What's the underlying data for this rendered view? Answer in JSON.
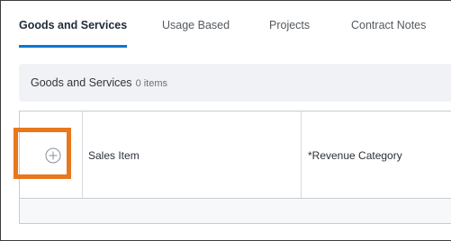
{
  "tabs": [
    {
      "label": "Goods and Services",
      "active": true
    },
    {
      "label": "Usage Based",
      "active": false
    },
    {
      "label": "Projects",
      "active": false
    },
    {
      "label": "Contract Notes",
      "active": false
    }
  ],
  "section": {
    "title": "Goods and Services",
    "count": "0 items"
  },
  "grid": {
    "add_icon": "plus-circle-icon",
    "columns": [
      "Sales Item",
      "*Revenue Category"
    ]
  },
  "colors": {
    "active_tab_underline": "#0b77d1",
    "highlight": "#e8781b",
    "section_bg": "#f0f2f5"
  }
}
